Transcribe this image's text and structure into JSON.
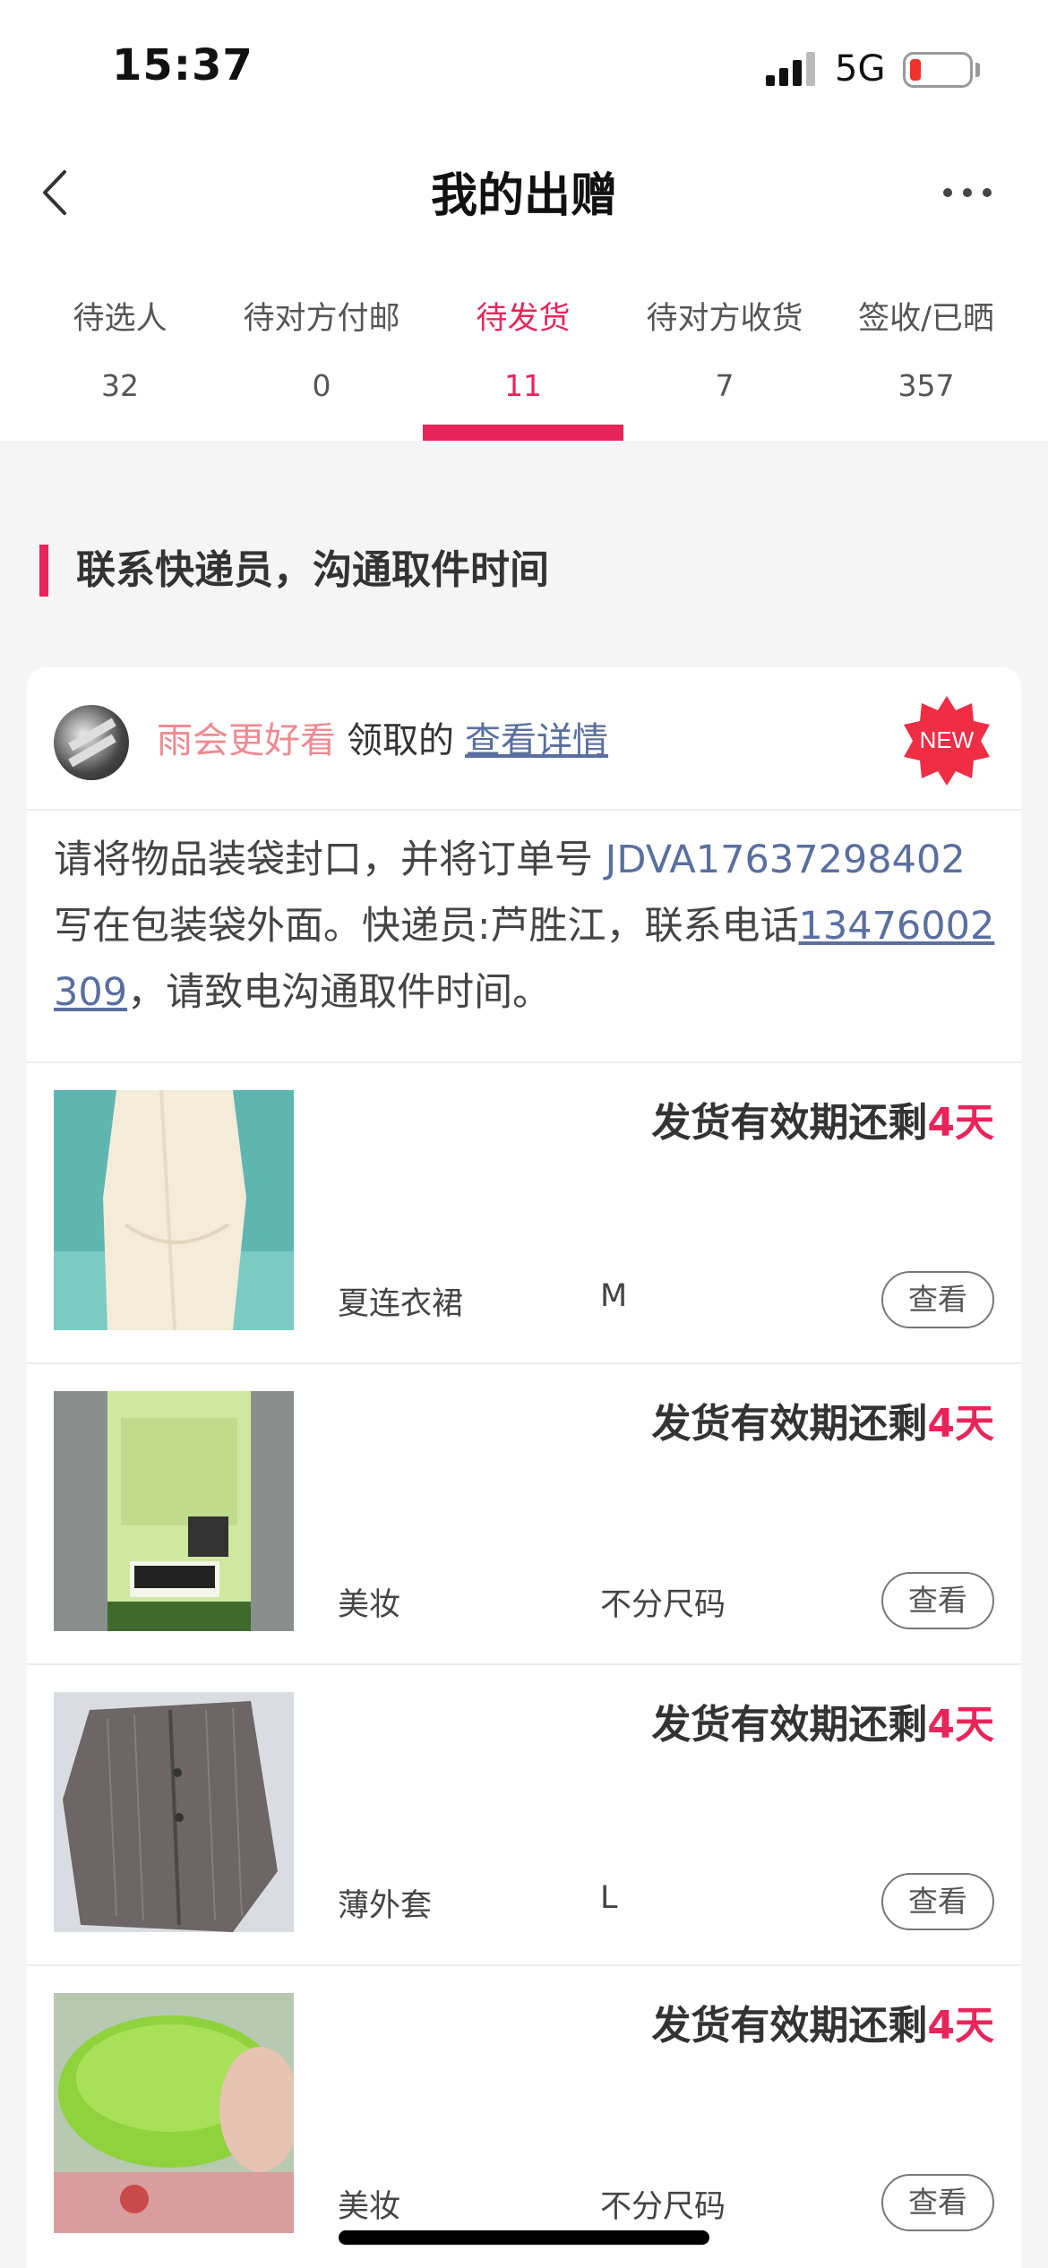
{
  "status_bar": {
    "time": "15:37",
    "network": "5G"
  },
  "nav": {
    "title": "我的出赠"
  },
  "tabs": [
    {
      "label": "待选人",
      "count": "32"
    },
    {
      "label": "待对方付邮",
      "count": "0"
    },
    {
      "label": "待发货",
      "count": "11",
      "active": true
    },
    {
      "label": "待对方收货",
      "count": "7"
    },
    {
      "label": "签收/已晒",
      "count": "357"
    }
  ],
  "section": {
    "title": "联系快递员，沟通取件时间"
  },
  "card": {
    "claimer": "雨会更好看",
    "claimed_text": "领取的",
    "detail_link": "查看详情",
    "badge": "NEW",
    "notice": {
      "prefix": "请将物品装袋封口，并将订单号 ",
      "order_no": "JDVA17637298402",
      "middle": " 写在包装袋外面。快递员:芦胜江，联系电话",
      "phone": "13476002309",
      "suffix": "，请致电沟通取件时间。"
    },
    "items": [
      {
        "deadline_prefix": "发货有效期还剩",
        "deadline_days": "4天",
        "name": "夏连衣裙",
        "size": "M",
        "button": "查看"
      },
      {
        "deadline_prefix": "发货有效期还剩",
        "deadline_days": "4天",
        "name": "美妆",
        "size": "不分尺码",
        "button": "查看"
      },
      {
        "deadline_prefix": "发货有效期还剩",
        "deadline_days": "4天",
        "name": "薄外套",
        "size": "L",
        "button": "查看"
      },
      {
        "deadline_prefix": "发货有效期还剩",
        "deadline_days": "4天",
        "name": "美妆",
        "size": "不分尺码",
        "button": "查看"
      }
    ]
  },
  "colors": {
    "accent": "#e8255a",
    "link": "#5a6f9f",
    "claimer": "#ef8a92"
  }
}
